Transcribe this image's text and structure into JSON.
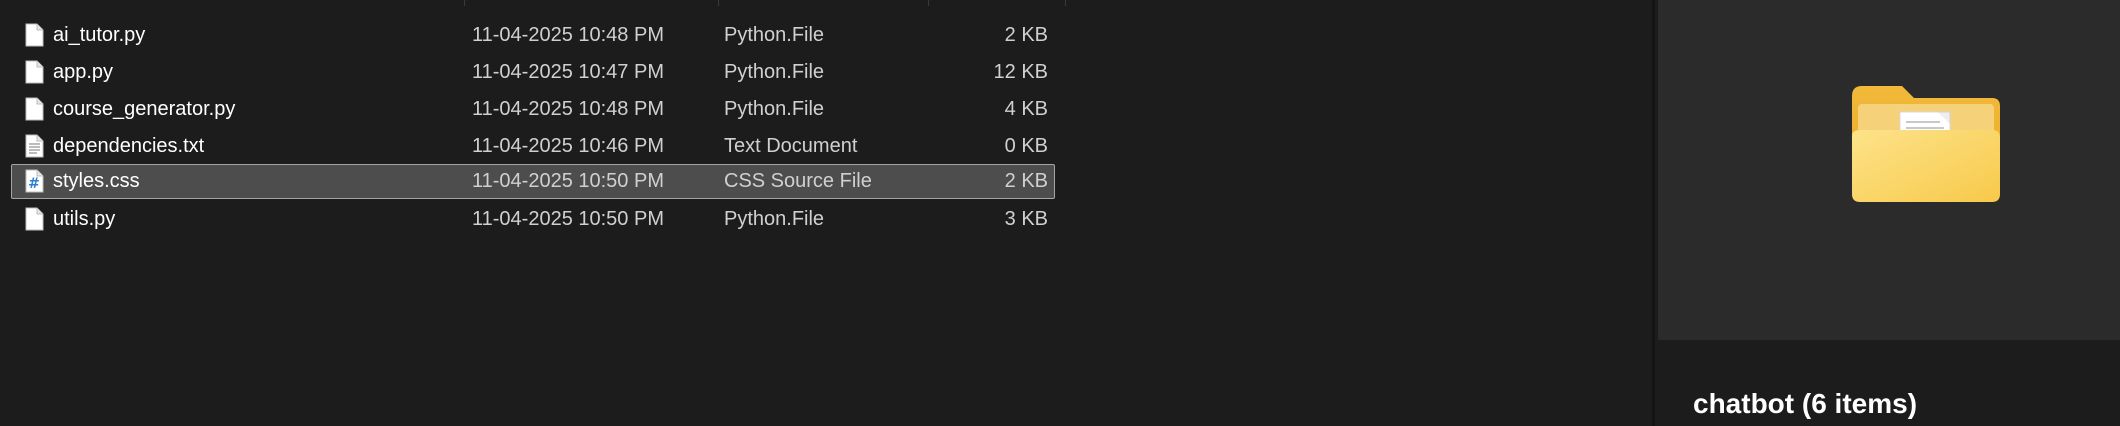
{
  "files": [
    {
      "name": "ai_tutor.py",
      "modified": "11-04-2025 10:48 PM",
      "type": "Python.File",
      "size": "2 KB",
      "icon": "document-icon",
      "selected": false
    },
    {
      "name": "app.py",
      "modified": "11-04-2025 10:47 PM",
      "type": "Python.File",
      "size": "12 KB",
      "icon": "document-icon",
      "selected": false
    },
    {
      "name": "course_generator.py",
      "modified": "11-04-2025 10:48 PM",
      "type": "Python.File",
      "size": "4 KB",
      "icon": "document-icon",
      "selected": false
    },
    {
      "name": "dependencies.txt",
      "modified": "11-04-2025 10:46 PM",
      "type": "Text Document",
      "size": "0 KB",
      "icon": "text-document-icon",
      "selected": false
    },
    {
      "name": "styles.css",
      "modified": "11-04-2025 10:50 PM",
      "type": "CSS Source File",
      "size": "2 KB",
      "icon": "css-file-icon",
      "selected": true
    },
    {
      "name": "utils.py",
      "modified": "11-04-2025 10:50 PM",
      "type": "Python.File",
      "size": "3 KB",
      "icon": "document-icon",
      "selected": false
    }
  ],
  "details": {
    "title": "chatbot (6 items)",
    "thumbnail_icon": "folder-icon"
  },
  "colors": {
    "background": "#1c1c1c",
    "selected_row": "#4d4d4d",
    "selected_border": "#a4a4a4",
    "preview_background": "#2b2b2b",
    "folder_yellow": "#f8c93e",
    "css_icon_blue": "#2f7fd1"
  }
}
